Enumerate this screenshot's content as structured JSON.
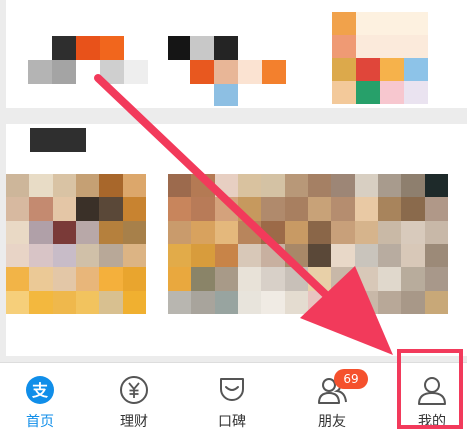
{
  "tabbar": {
    "tabs": [
      {
        "label": "首页",
        "icon": "alipay-logo-icon",
        "active": true
      },
      {
        "label": "理财",
        "icon": "yuan-coin-icon",
        "active": false
      },
      {
        "label": "口碑",
        "icon": "koubei-cup-icon",
        "active": false
      },
      {
        "label": "朋友",
        "icon": "friends-icon",
        "active": false,
        "badge": "69"
      },
      {
        "label": "我的",
        "icon": "person-icon",
        "active": false
      }
    ]
  },
  "colors": {
    "accent": "#108ee9",
    "badge": "#f5512d",
    "annotation": "#f23a5b"
  },
  "content": {
    "top_blurred_icons": 3,
    "mid_blurred_images": 2,
    "blurred_title_bar": true
  }
}
